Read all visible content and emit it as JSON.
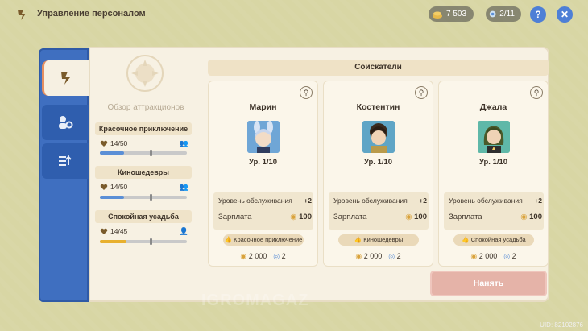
{
  "header": {
    "title": "Управление персоналом",
    "mora": "7 503",
    "staff_count": "2/11",
    "help_label": "?",
    "close_label": "✕"
  },
  "sidebar": {
    "tabs": [
      {
        "name": "staff",
        "icon": "pen-icon",
        "active": true
      },
      {
        "name": "attractions",
        "icon": "gear-people-icon",
        "active": false
      },
      {
        "name": "upgrade",
        "icon": "list-arrow-icon",
        "active": false
      }
    ]
  },
  "overview": {
    "title": "Обзор аттракционов",
    "attractions": [
      {
        "name": "Красочное приключение",
        "progress": "14/50",
        "fill_fraction": 0.28,
        "fill_color": "#5b8fd6"
      },
      {
        "name": "Киношедевры",
        "progress": "14/50",
        "fill_fraction": 0.28,
        "fill_color": "#5b8fd6"
      },
      {
        "name": "Спокойная усадьба",
        "progress": "14/45",
        "fill_fraction": 0.31,
        "fill_color": "#e8b02e"
      }
    ]
  },
  "applicants": {
    "header": "Соискатели",
    "cards": [
      {
        "name": "Марин",
        "level": "Ур. 1/10",
        "service_label": "Уровень обслуживания",
        "service_value": "+2",
        "salary_label": "Зарплата",
        "salary_value": "100",
        "tag": "Красочное приключение",
        "cost_mora": "2 000",
        "cost_points": "2",
        "avatar_bg": "#6fa6d6"
      },
      {
        "name": "Костентин",
        "level": "Ур. 1/10",
        "service_label": "Уровень обслуживания",
        "service_value": "+2",
        "salary_label": "Зарплата",
        "salary_value": "100",
        "tag": "Киношедевры",
        "cost_mora": "2 000",
        "cost_points": "2",
        "avatar_bg": "#5fa5c6"
      },
      {
        "name": "Джала",
        "level": "Ур. 1/10",
        "service_label": "Уровень обслуживания",
        "service_value": "+2",
        "salary_label": "Зарплата",
        "salary_value": "100",
        "tag": "Спокойная усадьба",
        "cost_mora": "2 000",
        "cost_points": "2",
        "avatar_bg": "#5fb8a8"
      }
    ]
  },
  "hire_button": "Нанять",
  "uid": "UID: 82102876",
  "watermark": "IGROMAGAZ"
}
